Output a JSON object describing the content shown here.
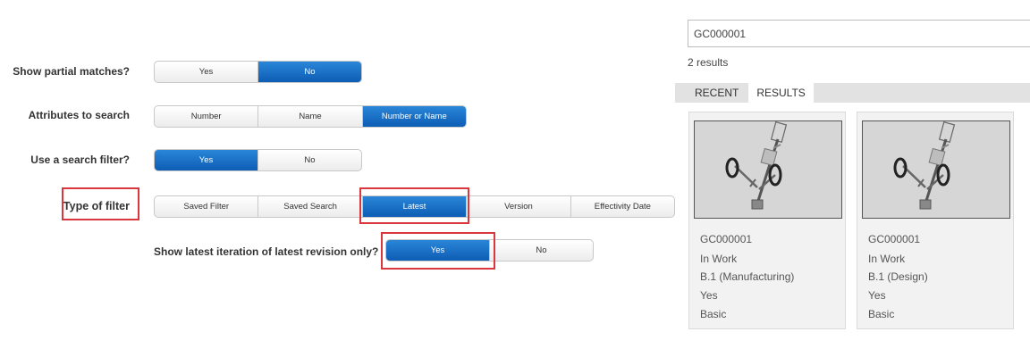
{
  "form": {
    "partial": {
      "label": "Show partial matches?",
      "options": [
        "Yes",
        "No"
      ],
      "selected": "No"
    },
    "attributes": {
      "label": "Attributes to search",
      "options": [
        "Number",
        "Name",
        "Number or Name"
      ],
      "selected": "Number or Name"
    },
    "use_filter": {
      "label": "Use a search filter?",
      "options": [
        "Yes",
        "No"
      ],
      "selected": "Yes"
    },
    "filter_type": {
      "label": "Type of filter",
      "options": [
        "Saved Filter",
        "Saved Search",
        "Latest",
        "Version",
        "Effectivity Date"
      ],
      "selected": "Latest"
    },
    "latest_only": {
      "label": "Show latest iteration of latest revision only?",
      "options": [
        "Yes",
        "No"
      ],
      "selected": "Yes"
    }
  },
  "colors": {
    "accent": "#0d5db4",
    "highlight": "#d9363e"
  },
  "search": {
    "value": "GC000001"
  },
  "results": {
    "count": "2 results",
    "tabs": [
      "RECENT",
      "RESULTS"
    ],
    "active_tab": "RESULTS",
    "cards": [
      {
        "number": "GC000001",
        "state": "In Work",
        "revision": "B.1 (Manufacturing)",
        "latest": "Yes",
        "type": "Basic",
        "thumbnail_icon": "golf-cart-model-icon"
      },
      {
        "number": "GC000001",
        "state": "In Work",
        "revision": "B.1 (Design)",
        "latest": "Yes",
        "type": "Basic",
        "thumbnail_icon": "golf-cart-model-icon"
      }
    ]
  }
}
